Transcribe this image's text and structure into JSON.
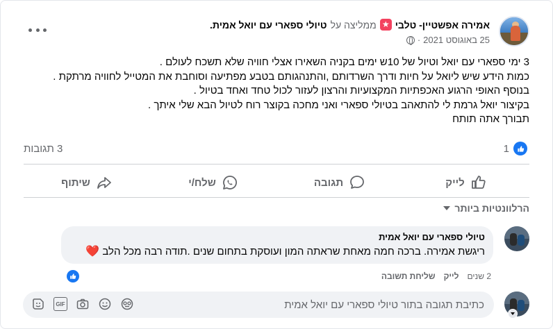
{
  "post": {
    "author": "אמירה אפשטיין- טלבי",
    "recommends_text": "ממליצה על",
    "page_name": "טיולי ספארי עם יואל אמית.",
    "date": "25 באוגוסט 2021",
    "separator": "·",
    "body_lines": [
      "3 ימי ספארי עם יואל וטיול של 10ש ימים בקניה  השאירו אצלי חוויה שלא תשכח לעולם .",
      "כמות הידע שיש ליואל על חיות ודרך השרדותם ,והתנהגותם בטבע  מפתיעה וסוחבת את המטייל לחוויה מרתקת .",
      "בנוסף האופי הרגוע האכפתיות המקצועיות והרצון לעזור לכול טחד ואחד בטיול .",
      "בקיצור יואל גרמת לי להתאהב בטיולי ספארי ואני מחכה בקוצר רוח לטיול הבא שלי איתך .",
      "תבורך אתה תותח"
    ],
    "like_count": "1",
    "comments_count": "3 תגובות"
  },
  "actions": {
    "like": "לייק",
    "comment": "תגובה",
    "send": "שלח/י",
    "share": "שיתוף"
  },
  "filter": {
    "label": "הרלוונטיות ביותר"
  },
  "comment": {
    "author": "טיולי ספארי עם יואל אמית",
    "text": "ריגשת אמירה. ברכה חמה מאחת שראתה המון ועוסקת בתחום שנים .תודה רבה מכל הלב",
    "heart": "❤️",
    "time": "2 שנים",
    "like_label": "לייק",
    "reply_label": "שליחת תשובה"
  },
  "composer": {
    "placeholder": "כתיבת תגובה בתור טיולי ספארי עם יואל אמית",
    "gif_label": "GIF"
  },
  "colors": {
    "facebook_blue": "#1877f2",
    "recommend_red": "#f3425f",
    "heart_red": "#e41e3f",
    "muted_text": "#65676b",
    "bubble_bg": "#f0f2f5"
  }
}
